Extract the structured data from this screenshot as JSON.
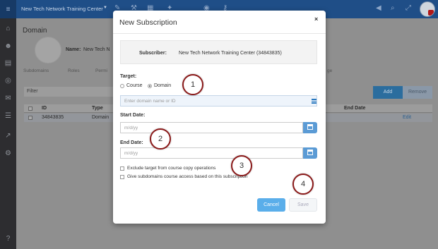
{
  "topbar": {
    "org_name": "New Tech Network Training Center",
    "icons": [
      "hamburger-icon",
      "pencil-icon",
      "wrench-icon",
      "calendar-icon",
      "ticket-icon",
      "binoculars-icon",
      "key-icon",
      "megaphone-icon",
      "search-icon",
      "expand-icon",
      "avatar"
    ]
  },
  "sidebar": {
    "icons": [
      "institution-icon",
      "users-icon",
      "book-icon",
      "target-icon",
      "mail-icon",
      "list-icon",
      "chart-icon",
      "gears-icon",
      "help-icon"
    ],
    "help_label": "?"
  },
  "main": {
    "title": "Domain",
    "name_label": "Name:",
    "name_value": "New Tech N",
    "tabs": [
      "Subdomains",
      "Roles",
      "Permi",
      "ge"
    ],
    "filter_label": "Filter",
    "add_label": "Add",
    "remove_label": "Remove",
    "columns": [
      "ID",
      "Type",
      "End Date"
    ],
    "row": {
      "id": "34843835",
      "type": "Domain",
      "action": "Edit"
    }
  },
  "modal": {
    "title": "New Subscription",
    "close": "×",
    "subscriber_label": "Subscriber:",
    "subscriber_value": "New Tech Network Training Center (34843835)",
    "target_label": "Target:",
    "target_options": [
      "Course",
      "Domain"
    ],
    "target_selected": "Domain",
    "domain_placeholder": "Enter domain name or ID",
    "start_date_label": "Start Date:",
    "start_date_placeholder": "m/d/yy",
    "end_date_label": "End Date:",
    "end_date_placeholder": "m/d/yy",
    "checkbox1": "Exclude target from course copy operations",
    "checkbox2": "Give subdomains course access based on this subscription",
    "cancel_label": "Cancel",
    "save_label": "Save"
  },
  "callouts": [
    "1",
    "2",
    "3",
    "4"
  ]
}
